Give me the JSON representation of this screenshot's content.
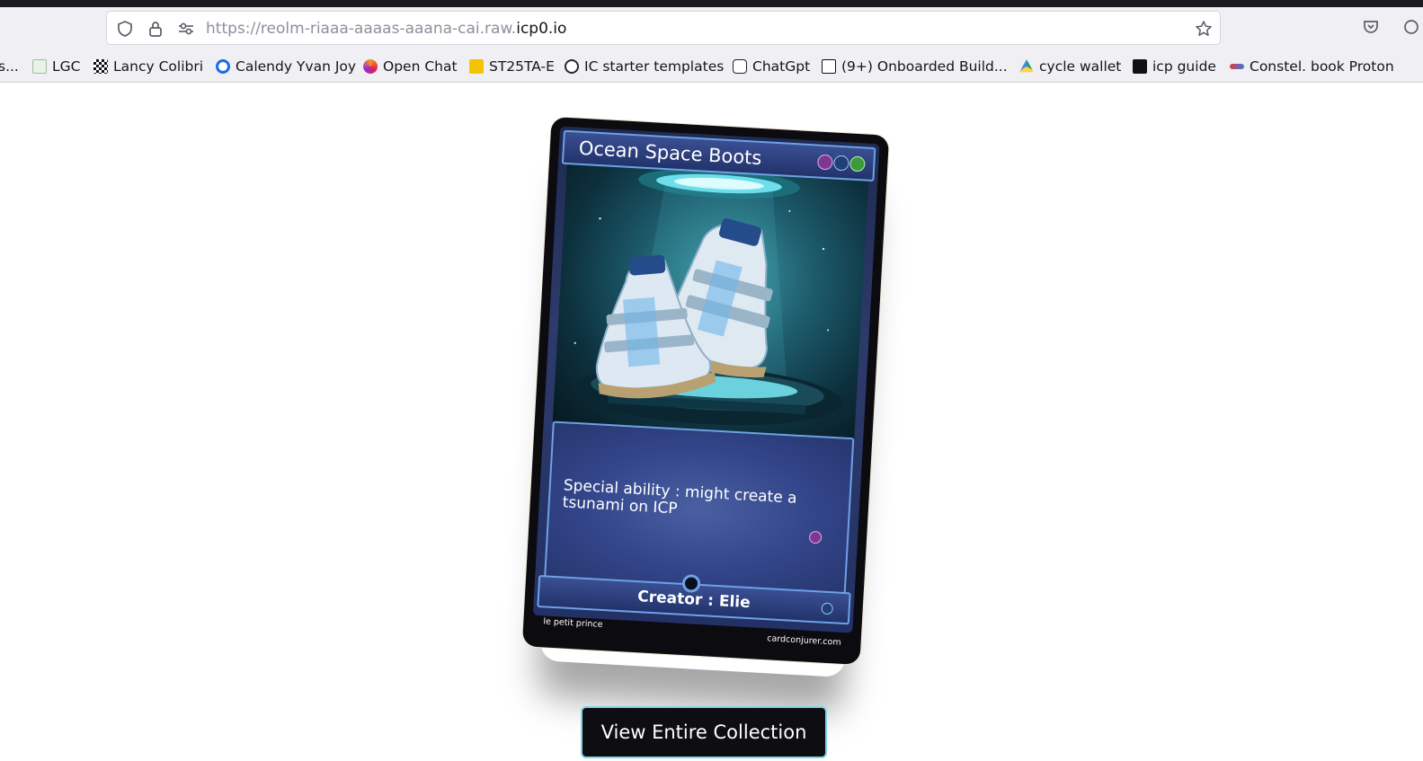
{
  "browser": {
    "url_prefix": "https://reolm-riaaa-aaaas-aaana-cai.raw.",
    "url_domain": "icp0.io",
    "icons": {
      "shield": "shield-icon",
      "lock": "lock-icon",
      "permissions": "permissions-icon",
      "bookmark_star": "star-icon",
      "pocket": "pocket-icon"
    }
  },
  "bookmarks": [
    {
      "label": "s...",
      "icon": "bookmark-favicon"
    },
    {
      "label": "LGC",
      "icon": "lgc-favicon"
    },
    {
      "label": "Lancy Colibri",
      "icon": "checker-favicon"
    },
    {
      "label": "Calendy Yvan Joy",
      "icon": "calendly-favicon"
    },
    {
      "label": "Open Chat",
      "icon": "openchat-favicon"
    },
    {
      "label": "ST25TA-E",
      "icon": "st-favicon"
    },
    {
      "label": "IC starter templates",
      "icon": "github-favicon"
    },
    {
      "label": "ChatGpt",
      "icon": "openai-favicon"
    },
    {
      "label": "(9+) Onboarded Build...",
      "icon": "notion-favicon"
    },
    {
      "label": "cycle wallet",
      "icon": "gdrive-favicon"
    },
    {
      "label": "icp guide",
      "icon": "bolt-favicon"
    },
    {
      "label": "Constel. book Proton",
      "icon": "constel-favicon"
    }
  ],
  "card": {
    "title": "Ocean Space Boots",
    "ability": "Special ability : might create a tsunami on ICP",
    "creator": "Creator : Elie",
    "footer_left": "le petit prince",
    "footer_right": "cardconjurer.com",
    "colors": {
      "frame": "#2d3a6a",
      "border": "#6ea2e6",
      "mana_psychic": "#c97bd6",
      "mana_water": "#2e6fbf",
      "mana_nature": "#4cb84a"
    }
  },
  "actions": {
    "view_collection": "View Entire Collection"
  }
}
